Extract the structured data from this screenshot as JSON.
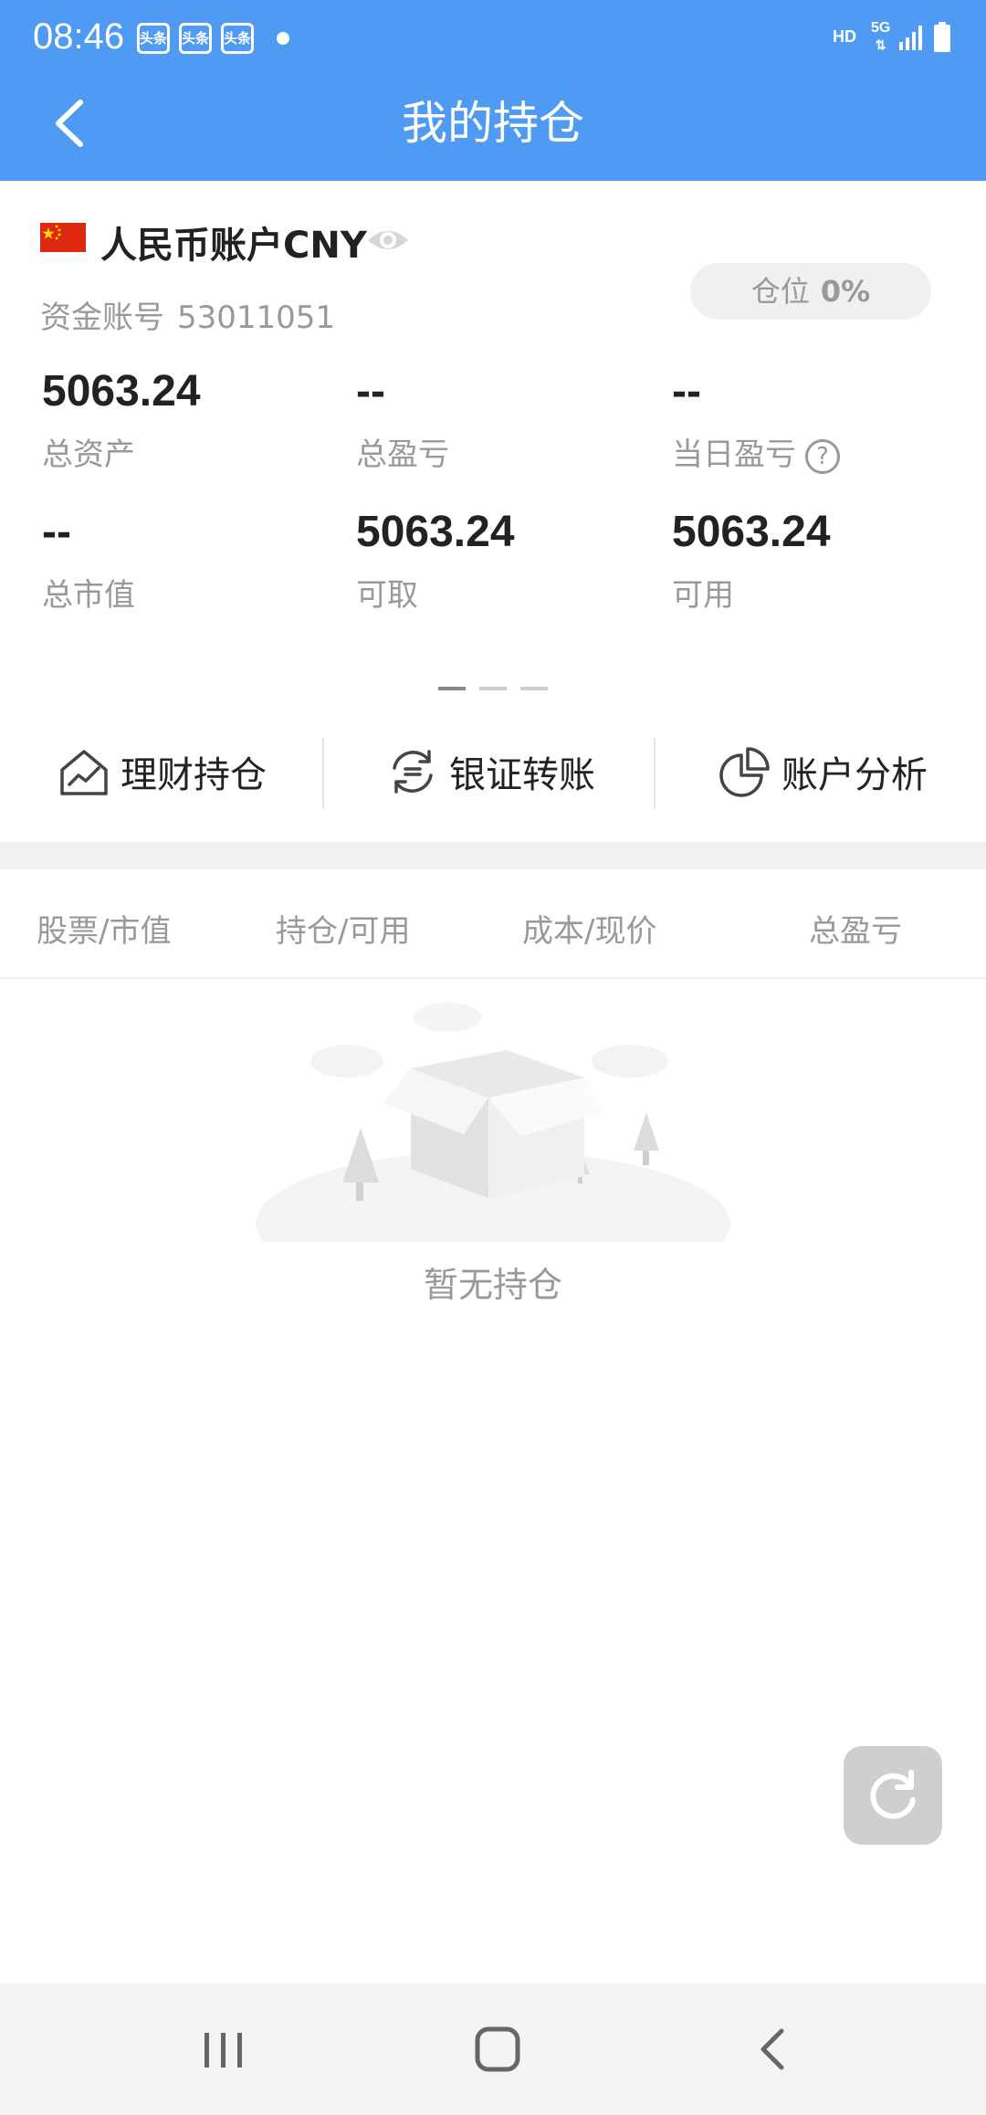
{
  "status_bar": {
    "time": "08:46",
    "notif_label": "头条",
    "network_hd": "HD",
    "network_5g": "5G"
  },
  "header": {
    "title": "我的持仓"
  },
  "account": {
    "name": "人民币账户CNY",
    "number_label": "资金账号",
    "number": "53011051",
    "position_label": "仓位",
    "position_value": "0%"
  },
  "metrics": [
    {
      "value": "5063.24",
      "label": "总资产"
    },
    {
      "value": "--",
      "label": "总盈亏"
    },
    {
      "value": "--",
      "label": "当日盈亏"
    },
    {
      "value": "--",
      "label": "总市值"
    },
    {
      "value": "5063.24",
      "label": "可取"
    },
    {
      "value": "5063.24",
      "label": "可用"
    }
  ],
  "actions": [
    {
      "label": "理财持仓",
      "icon": "house-chart-icon"
    },
    {
      "label": "银证转账",
      "icon": "transfer-cycle-icon"
    },
    {
      "label": "账户分析",
      "icon": "pie-chart-icon"
    }
  ],
  "table_headers": [
    "股票/市值",
    "持仓/可用",
    "成本/现价",
    "总盈亏"
  ],
  "empty_state": {
    "text": "暂无持仓"
  },
  "colors": {
    "brand": "#4f9bf3",
    "muted": "#999999",
    "strong": "#222222"
  }
}
